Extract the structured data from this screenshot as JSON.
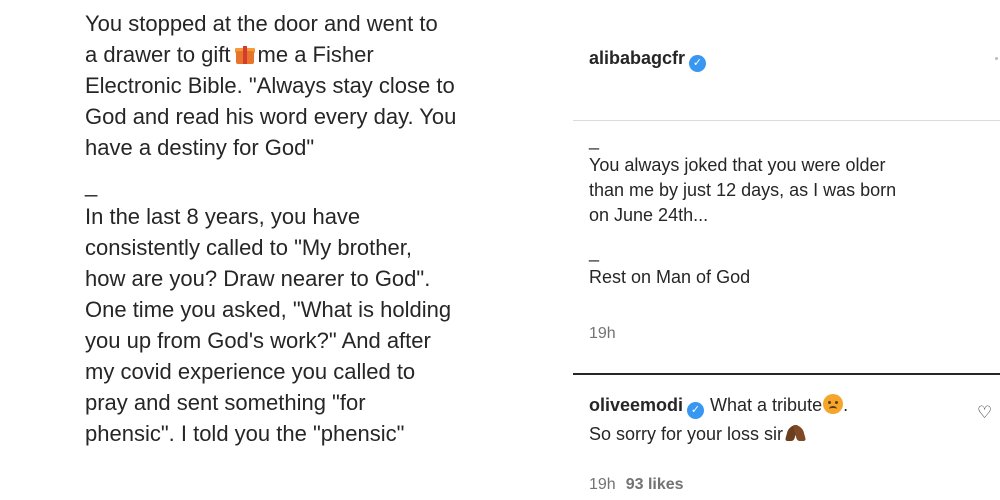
{
  "post_caption": {
    "lines": [
      "_",
      "You stopped at the door and went to",
      "a drawer to gift",
      "me a Fisher",
      "Electronic Bible. \"Always stay close to",
      "God and read his word every day. You",
      "have a destiny for God\"",
      "_",
      "In the last 8 years, you have",
      "consistently called to \"My brother,",
      "how are you? Draw nearer to God\".",
      "One time you asked, \"What is holding",
      "you up from God's work?\" And after",
      "my covid experience you called to",
      "pray and sent something \"for",
      "phensic\". I told you the \"phensic\""
    ]
  },
  "comment": {
    "username": "alibabagcfr",
    "body_lines": [
      "_",
      "You always joked that you were older",
      "than me by just 12 days, as I was born",
      "on June 24th...",
      "",
      "_",
      "Rest on Man of God"
    ],
    "timestamp": "19h"
  },
  "reply": {
    "username": "oliveemodi",
    "text_part1": "What a tribute",
    "text_part2": ".",
    "line2": "So sorry for your loss sir",
    "timestamp": "19h",
    "likes": "93 likes"
  },
  "icons": {
    "verified": "verified-badge-icon",
    "gift": "gift-emoji-icon",
    "sad": "sad-face-emoji-icon",
    "pray": "praying-hands-emoji-icon",
    "heart": "heart-outline-icon"
  },
  "colors": {
    "verified": "#3897f0",
    "text": "#262626",
    "muted": "#737373"
  }
}
